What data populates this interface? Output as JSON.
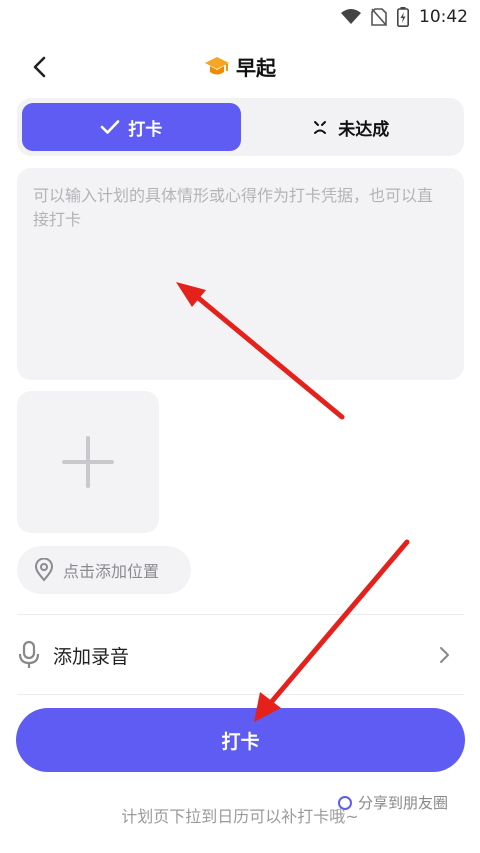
{
  "status_bar": {
    "time": "10:42",
    "icons": [
      "wifi-icon",
      "no-sim-icon",
      "battery-charging-icon"
    ]
  },
  "header": {
    "title": "早起",
    "back_icon": "chevron-left-icon",
    "title_icon": "graduation-cap-icon"
  },
  "segment": {
    "checkin_label": "打卡",
    "missed_label": "未达成",
    "active": "checkin"
  },
  "note": {
    "placeholder": "可以输入计划的具体情形或心得作为打卡凭据，也可以直接打卡",
    "value": ""
  },
  "photo": {
    "icon": "plus-icon"
  },
  "location": {
    "label": "点击添加位置",
    "icon": "location-pin-icon"
  },
  "audio": {
    "label": "添加录音",
    "icon": "microphone-icon"
  },
  "primary_button": {
    "label": "打卡"
  },
  "share": {
    "label": "分享到朋友圈",
    "checked": false
  },
  "hint": {
    "text": "计划页下拉到日历可以补打卡哦~"
  },
  "colors": {
    "accent": "#5e5cf3",
    "surface": "#f3f3f5",
    "annotation": "#e5211c",
    "title_icon": "#f5a623"
  }
}
